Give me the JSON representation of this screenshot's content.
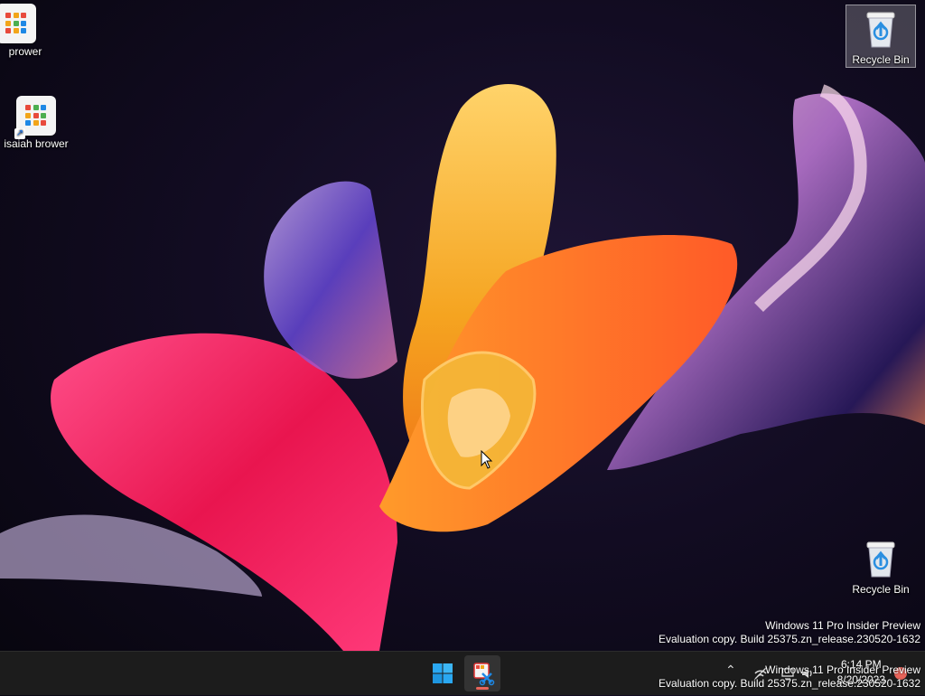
{
  "desktop": {
    "icons": [
      {
        "label": "prower"
      },
      {
        "label": "isaiah brower"
      },
      {
        "label": "Recycle Bin"
      },
      {
        "label": "Recycle Bin"
      }
    ],
    "watermark": {
      "line1": "Windows 11 Pro Insider Preview",
      "line2": "Evaluation copy. Build 25375.zn_release.230520-1632"
    }
  },
  "taskbar": {
    "apps": [
      {
        "icon": "windows-start-icon"
      },
      {
        "icon": "snipping-tool-icon",
        "running": true
      }
    ],
    "tray": {
      "icons": [
        "chevron-up-icon",
        "network-icon",
        "display-icon",
        "volume-icon"
      ],
      "time": "6:14 PM",
      "date": "8/20/2023"
    }
  },
  "colors": {
    "taskbar": "#1c1c1c",
    "accent": "#e8645a",
    "windows_blue": "#2aa8f2"
  }
}
